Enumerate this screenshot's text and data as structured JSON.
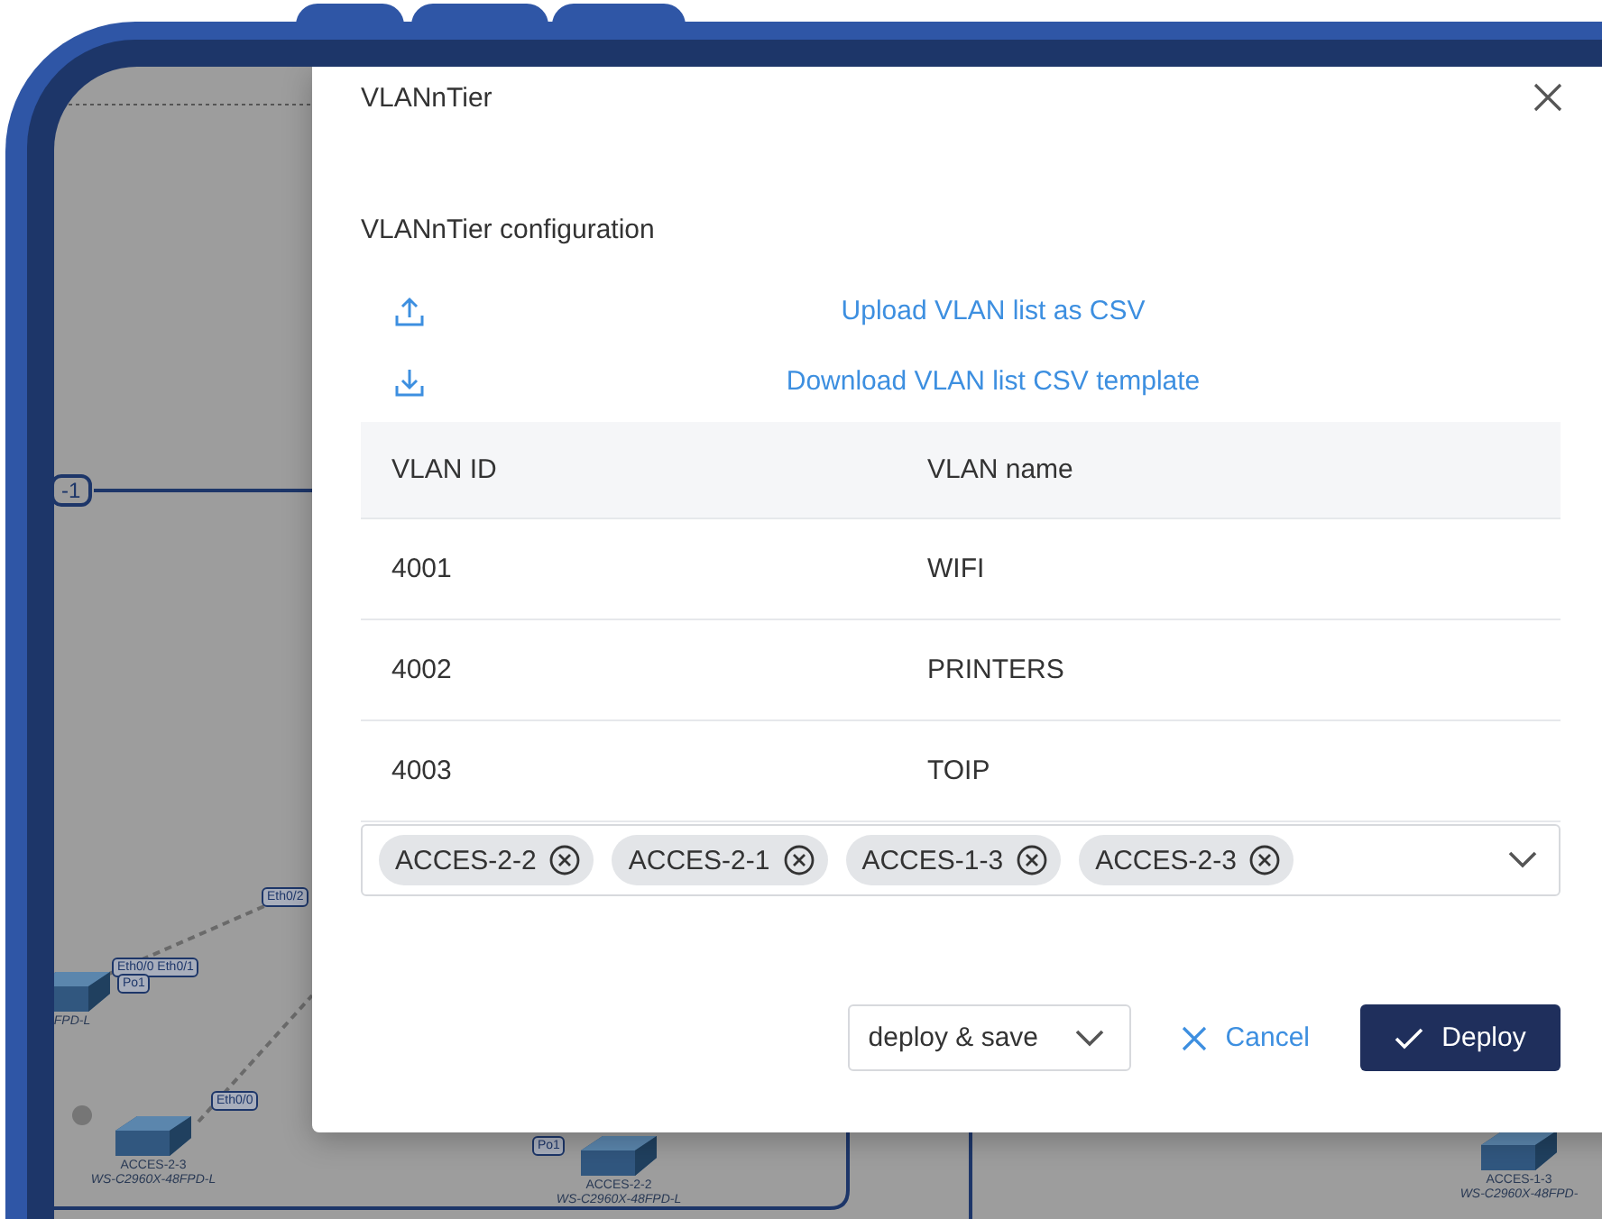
{
  "canvas": {
    "link_label": "-1",
    "port_labels": [
      "Eth0/2",
      "Eth0/0 Eth0/1",
      "Po1",
      "Eth0/0",
      "Po1"
    ],
    "nodes": [
      {
        "model": "FPD-L"
      },
      {
        "name": "ACCES-2-3",
        "model": "WS-C2960X-48FPD-L"
      },
      {
        "name": "ACCES-2-2",
        "model": "WS-C2960X-48FPD-L"
      },
      {
        "name": "ACCES-1-3",
        "model": "WS-C2960X-48FPD-"
      }
    ]
  },
  "dialog": {
    "title": "VLANnTier",
    "subtitle": "VLANnTier configuration",
    "actions": [
      {
        "kind": "upload",
        "label": "Upload VLAN list as CSV"
      },
      {
        "kind": "download",
        "label": "Download VLAN list CSV template"
      }
    ],
    "table": {
      "columns": [
        "VLAN ID",
        "VLAN name"
      ],
      "rows": [
        [
          "4001",
          "WIFI"
        ],
        [
          "4002",
          "PRINTERS"
        ],
        [
          "4003",
          "TOIP"
        ]
      ]
    },
    "devices": [
      "ACCES-2-2",
      "ACCES-2-1",
      "ACCES-1-3",
      "ACCES-2-3"
    ],
    "footer": {
      "mode": "deploy & save",
      "cancel": "Cancel",
      "deploy": "Deploy"
    }
  }
}
